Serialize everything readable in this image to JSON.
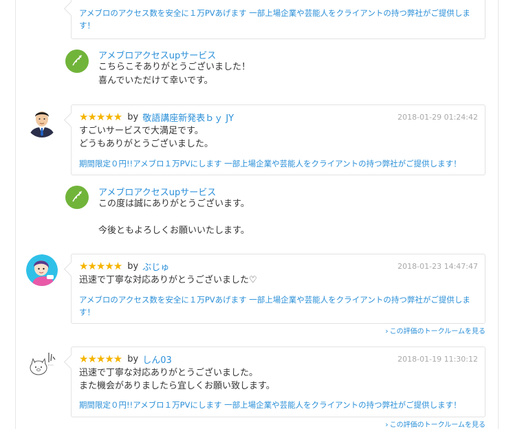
{
  "colors": {
    "link": "#2a8fd8",
    "star": "#f5b400",
    "reply_avatar": "#71b43a",
    "date": "#a9a9a9"
  },
  "top": {
    "service_text": "アメブロのアクセス数を安全に１万PVあげます 一部上場企業や芸能人をクライアントの持つ弊社がご提供しま す！"
  },
  "replies": [
    {
      "name": "アメブロアクセスupサービス",
      "text": "こちらこそありがとうございました！\n喜んでいただけて幸いです。"
    },
    {
      "name": "アメブロアクセスupサービス",
      "text": "この度は誠にありがとうございます。\n\n今後ともよろしくお願いいたします。"
    }
  ],
  "reviews": [
    {
      "stars": "★★★★★",
      "by": "by",
      "reviewer": "敬語講座新発表ｂｙ JY",
      "date": "2018-01-29 01:24:42",
      "text": "すごいサービスで大満足です。\nどうもありがとうございました。",
      "service": "期間限定０円!!アメブロ１万PVにします 一部上場企業や芸能人をクライアントの持つ弊社がご提供します！"
    },
    {
      "stars": "★★★★★",
      "by": "by",
      "reviewer": "ぶじゅ",
      "date": "2018-01-23 14:47:47",
      "text": "迅速で丁寧な対応ありがとうございました♡",
      "service": "アメブロのアクセス数を安全に１万PVあげます 一部上場企業や芸能人をクライアントの持つ弊社がご提供しま す！",
      "talk_link": "この評価のトークルームを見る"
    },
    {
      "stars": "★★★★★",
      "by": "by",
      "reviewer": "しん03",
      "date": "2018-01-19 11:30:12",
      "text": "迅速で丁寧な対応ありがとうございました。\nまた機会がありましたら宜しくお願い致します。",
      "service": "期間限定０円!!アメブロ１万PVにします 一部上場企業や芸能人をクライアントの持つ弊社がご提供します！",
      "talk_link": "この評価のトークルームを見る"
    }
  ]
}
